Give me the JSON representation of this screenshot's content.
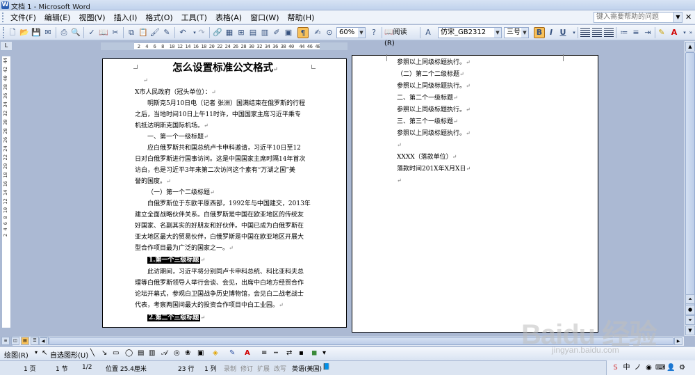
{
  "window": {
    "title": "文档 1 - Microsoft Word"
  },
  "menubar": {
    "items": [
      "文件(F)",
      "编辑(E)",
      "视图(V)",
      "插入(I)",
      "格式(O)",
      "工具(T)",
      "表格(A)",
      "窗口(W)",
      "帮助(H)"
    ],
    "help_placeholder": "键入需要帮助的问题"
  },
  "toolbar": {
    "zoom": "60%",
    "read_label": "阅读(R)",
    "font_name": "仿宋_GB2312",
    "font_size": "三号",
    "bold": "B",
    "italic": "I",
    "underline": "U"
  },
  "ruler": {
    "h_numbers": "6  4  2     2  4  6  8  10 12 14 16 18 20 22 24 26 28 30 32 34 36 38 40  44 46 48",
    "v_numbers": "2 4 6 8 10 12 14 16 18 20 22 24 26 28 30 32 34 36 38 40 42 44"
  },
  "page1": {
    "title": "怎么设置标准公文格式",
    "lines": [
      "X市人民政府（冠头单位）：",
      "明斯克5月10日电（记者 张洲）国满结束在俄罗斯的行程",
      "之后，当地时间10日上午11时许，中国国家主席习近平乘专",
      "机抵达明斯克国际机场。",
      "一、第一个一级标题",
      "应白俄罗斯共和国总统卢卡申科邀请，习近平10日至12",
      "日对白俄罗斯进行国事访问。这是中国国家主席时隔14年首次",
      "访白，也是习近平3年来第二次访问这个素有“万湖之国”美",
      "誉的国度。",
      "（一）第一个二级标题",
      "白俄罗斯位于东欧平原西部，1992年与中国建交，2013年",
      "建立全面战略伙伴关系。白俄罗斯是中国在欧亚地区的传统友",
      "好国家、名副其实的好朋友和好伙伴。中国已成为白俄罗斯在",
      "亚太地区最大的贸易伙伴，白俄罗斯是中国在欧亚地区开展大",
      "型合作项目最为广泛的国家之一。",
      "1.第一个三级标题",
      "此访期间，习近平将分别同卢卡申科总统、科比亚科夫总",
      "理等白俄罗斯领导人举行会谈、会见，出席中白地方经贸合作",
      "论坛开幕式，参观白卫国战争历史博物馆，会见白二战老战士",
      "代表，考察两国间最大的投资合作项目中白工业园。",
      "2.第二个三级标题"
    ]
  },
  "page2": {
    "lines": [
      "参照以上同级标题执行。",
      "（二）第二个二级标题",
      "参照以上同级标题执行。",
      "二、第二个一级标题",
      "参照以上同级标题执行。",
      "三、第三个一级标题",
      "参照以上同级标题执行。",
      "",
      "XXXX（落款单位）",
      "落款时间201X年X月X日",
      ""
    ]
  },
  "drawbar": {
    "draw_label": "绘图(R)",
    "autoshape_label": "自选图形(U)"
  },
  "statusbar": {
    "page": "1 页",
    "section": "1 节",
    "page_of": "1/2",
    "position": "位置 25.4厘米",
    "line": "23 行",
    "column": "1 列",
    "rec": "录制",
    "trk": "修订",
    "ext": "扩展",
    "ovr": "改写",
    "language": "英语(美国)"
  },
  "watermark": {
    "logo": "Baidu 经验",
    "url": "jingyan.baidu.com"
  }
}
